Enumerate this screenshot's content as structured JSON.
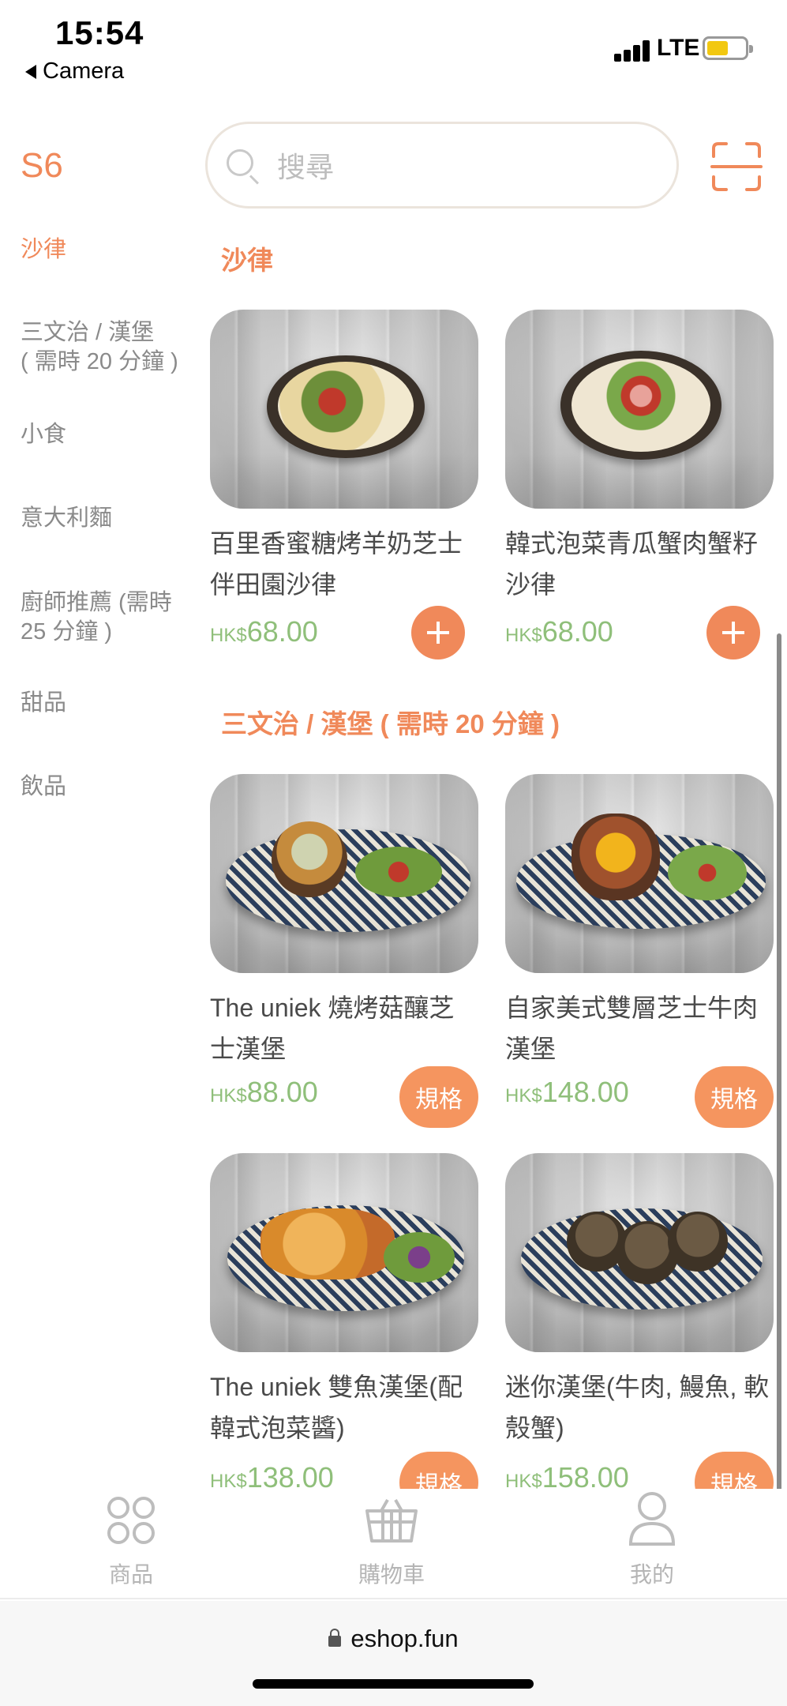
{
  "status": {
    "time": "15:54",
    "back_app": "Camera",
    "network": "LTE"
  },
  "header": {
    "store_code": "S6",
    "search_placeholder": "搜尋",
    "icons": {
      "search": "search-icon",
      "scan": "scan-icon"
    }
  },
  "sidebar": {
    "items": [
      {
        "label": "沙律",
        "active": true
      },
      {
        "label": "三文治 / 漢堡\n( 需時 20 分鐘 )",
        "active": false
      },
      {
        "label": "小食",
        "active": false
      },
      {
        "label": "意大利麵",
        "active": false
      },
      {
        "label": "廚師推薦 (需時\n25 分鐘 )",
        "active": false
      },
      {
        "label": "甜品",
        "active": false
      },
      {
        "label": "飲品",
        "active": false
      }
    ]
  },
  "sections": [
    {
      "title": "沙律",
      "products": [
        {
          "name": "百里香蜜糖烤羊奶芝士伴田園沙律",
          "currency": "HK$",
          "price": "68.00",
          "action": "add"
        },
        {
          "name": "韓式泡菜青瓜蟹肉蟹籽沙律",
          "currency": "HK$",
          "price": "68.00",
          "action": "add"
        }
      ]
    },
    {
      "title": "三文治 / 漢堡 ( 需時 20 分鐘 )",
      "products": [
        {
          "name": "The uniek 燒烤菇釀芝士漢堡",
          "currency": "HK$",
          "price": "88.00",
          "action_label": "規格"
        },
        {
          "name": "自家美式雙層芝士牛肉漢堡",
          "currency": "HK$",
          "price": "148.00",
          "action_label": "規格"
        },
        {
          "name": "The uniek 雙魚漢堡(配韓式泡菜醬)",
          "currency": "HK$",
          "price": "138.00",
          "action_label": "規格"
        },
        {
          "name": "迷你漢堡(牛肉, 鰻魚, 軟殼蟹)",
          "currency": "HK$",
          "price": "158.00",
          "action_label": "規格"
        }
      ]
    }
  ],
  "bottom_nav": {
    "items": [
      {
        "label": "商品",
        "icon": "grid-icon"
      },
      {
        "label": "購物車",
        "icon": "basket-icon"
      },
      {
        "label": "我的",
        "icon": "user-icon"
      }
    ]
  },
  "browser": {
    "url": "eshop.fun"
  },
  "colors": {
    "accent": "#f0895a",
    "price": "#8fbf7a",
    "muted": "#8a8a8a"
  }
}
